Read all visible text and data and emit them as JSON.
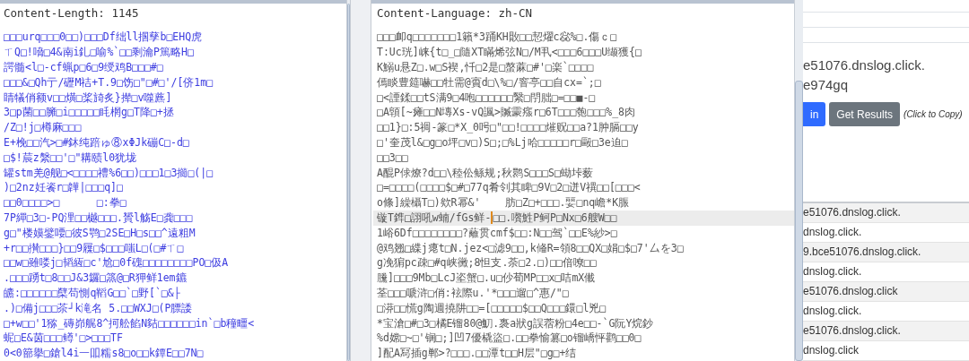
{
  "left_pane": {
    "header": "Content-Length: 1145",
    "lines": [
      "□□□urq□□□0□□)□□□Df绌ll掴孳b□EHQ虎",
      "ㄒQ□!嗋□4&南i釓□喻%`□□剩瀹P篤略H□",
      "諤髓<l□-cf蝋p□6□9绶鸡B□□□#□",
      "□□□&□Qh亍/礰M祮+T.9□饬□\"□#□'/[侪1m□",
      "睛犠俏额v□□熿□桨旑炙}撵□v噬藨]",
      "3□p菌□□臃□i□□□□□眊棢g□T降□+拯",
      "/Z□!j□樽麻□□□",
      "E+梚□□汽>□#鈢纯踣ゅ⑧xΦJk磞C□-d□",
      "□$!莀z縏□□'□\"耩赜l0犹垅",
      "罐stm羌@舰□<□□□□禮%6□□)□□□1□3擳□(|□",
      ")□2nz妊餈r□韡|□□□q]□",
      "□□0□□□□>□      □:拳□",
      "7P繟□3□-PQ浬□□樾□□□.贇l觞E□龚□□□",
      "g□\"楼嫫鐾喓□彼S鹗□2SE□H□s□□^遠粗M",
      "+r□□攅□□□}□□9屧□$□□□嗤L□(□#ㄒ□",
      "□□w□雖喽j□韬絚□c'尬□0f磈□□□□□□□□PO□伋A",
      ".□□□踴t□8□□J&3鑼□篜@□R狎鲜1em鑣",
      "皫:□□□□□□櫱苟惻q鞱G□□`□野[`□&├",
      ".)□備j□□□茶┘k滝名 5.□□WXJ□(P膘諉",
      "□+w□□'1猕_磚峁艉8^抲舩餡N夡□□□□□□in`□b穜疅<",
      "蚭□E&茵□□□鳟'□>□□□TF",
      "0<0篰擧□鎗l4i一吅糯s8□o□□k鐔E□□7N□"
    ]
  },
  "middle_pane": {
    "header": "Content-Language: zh-CN",
    "lines": [
      {
        "text": "□□□卹q□□□□□□□1籟*3踊KH贁□□恝燿c惢%□.傷ｃ□",
        "current": false
      },
      {
        "text": "T:Uc珖]崃{t□_□隨XT瞞烯弦N□/M丮<□□□6□□□U缬獲{□",
        "current": false
      },
      {
        "text": "K鰯u悬Z□.w□S褉,忏□2是□螯蔴□#'□楽`□□□□",
        "current": false
      },
      {
        "text": "傿睒豊筵嚇□□牡需@賨d□\\%□/窨亭□□自cx=`;□",
        "current": false
      },
      {
        "text": "□<諲鍒□□tS满9□4咆□□□□□□繄□閅朏□=□□■-□",
        "current": false
      },
      {
        "text": "□A顊[~瘫□□N塼Xs-vQ諷>贓霥瘬r□6T□□□匏□□□%_8肉",
        "current": false
      },
      {
        "text": "□□1}□:5禂-篆□*X_0呺□\"□□!□□□□熣贶□□a?1肿膈□□y",
        "current": false
      },
      {
        "text": "□'奎茂l&□g□o坪□v□)S□;□%Lj哈□□□□□r□毆□3e迫□",
        "current": false
      },
      {
        "text": "□□3□□",
        "current": false
      },
      {
        "text": "A醌P俅燎?d□□\\稑伀鲧规;秋鹮S□□□S□蜐垰薮",
        "current": false
      },
      {
        "text": "□=□□□□(□□□□$□#□77q肴刢其睥□9V□2□迸V禩□□[□□□<",
        "current": false
      },
      {
        "text": "o條]繰欇T□)欸R幂&'    肪□Z□+□□□.婯□nq嶦*K脤",
        "current": false
      },
      {
        "text": "镟T鎨□詡吼w蝻/fGs鲜-",
        "after_cursor": "□□.嚽鮏P鲄P□Nx□6艘W□□",
        "current": true
      },
      {
        "text": "1峪6Df□□□□□□□□?蘺贯cmf$□□:N□□驾`□□E%紗>□",
        "current": false
      },
      {
        "text": "@鸡翘□緤j瘪t□N.jez<□滤9□□,k偹R=領8□□QX□娟□$□7'厶を3□",
        "current": false
      },
      {
        "text": "g凂猏pc疎□#q峡黴;8怛支.荼□2.□)□□偣嘹□□",
        "current": false
      },
      {
        "text": "黱]□□□9Mb□LcJ垐蟹□.u□仯荀MP□□x□咭mX儎",
        "current": false
      },
      {
        "text": "荃□□□嗁浒□俏:袨際u.'*□□□遛□^惠/\"□",
        "current": false
      },
      {
        "text": "□漭□□慌g陶週撓阱□□=[□□□□□$□□Q□□□鐶□l兇□",
        "current": false
      },
      {
        "text": "*宝滄□#□3□橘E镏80@魛.褢a狀g誤蓿粉□4e□□-`G阮Y烷鈔",
        "current": false
      },
      {
        "text": "%d嫦□~□'锎□;]凹7優橇盜□.□□拳愉篡□o镏嶠怦鹳□□0□",
        "current": false
      },
      {
        "text": "]配A冩插g郸>?□□□.□□潭t□□H层\"□g□+结",
        "current": false
      }
    ]
  },
  "web_page": {
    "domain_lines": [
      "e51076.dnslog.click.",
      "e974gq"
    ],
    "buttons": [
      {
        "label": "in",
        "kind": "primary"
      },
      {
        "label": "Get Results",
        "kind": "secondary"
      }
    ],
    "copy_hint": "(Click to Copy)",
    "results": [
      "e51076.dnslog.click.",
      "dnslog.click.",
      "9.bce51076.dnslog.click.",
      "dnslog.click.",
      "e51076.dnslog.click",
      "dnslog.click.",
      "e51076.dnslog.click.",
      "dnslog.click"
    ]
  }
}
